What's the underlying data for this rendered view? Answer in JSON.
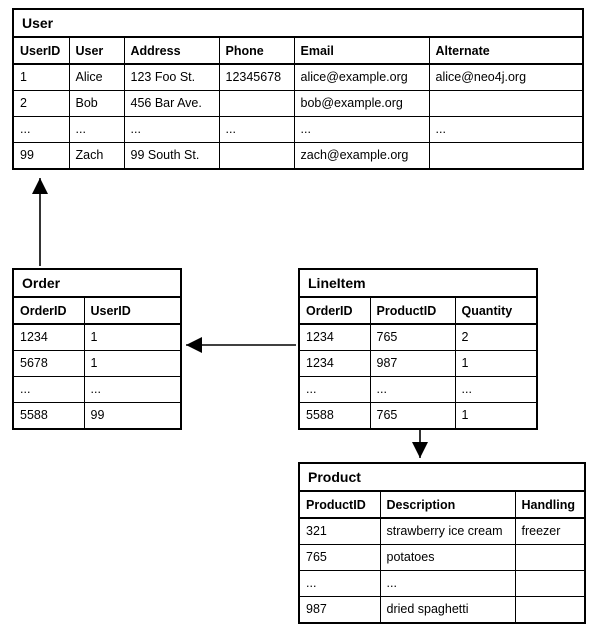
{
  "user": {
    "title": "User",
    "headers": [
      "UserID",
      "User",
      "Address",
      "Phone",
      "Email",
      "Alternate"
    ],
    "rows": [
      [
        "1",
        "Alice",
        "123 Foo St.",
        "12345678",
        "alice@example.org",
        "alice@neo4j.org"
      ],
      [
        "2",
        "Bob",
        "456 Bar Ave.",
        "",
        "bob@example.org",
        ""
      ],
      [
        "...",
        "...",
        "...",
        "...",
        "...",
        "..."
      ],
      [
        "99",
        "Zach",
        "99 South St.",
        "",
        "zach@example.org",
        ""
      ]
    ]
  },
  "order": {
    "title": "Order",
    "headers": [
      "OrderID",
      "UserID"
    ],
    "rows": [
      [
        "1234",
        "1"
      ],
      [
        "5678",
        "1"
      ],
      [
        "...",
        "..."
      ],
      [
        "5588",
        "99"
      ]
    ]
  },
  "lineitem": {
    "title": "LineItem",
    "headers": [
      "OrderID",
      "ProductID",
      "Quantity"
    ],
    "rows": [
      [
        "1234",
        "765",
        "2"
      ],
      [
        "1234",
        "987",
        "1"
      ],
      [
        "...",
        "...",
        "..."
      ],
      [
        "5588",
        "765",
        "1"
      ]
    ]
  },
  "product": {
    "title": "Product",
    "headers": [
      "ProductID",
      "Description",
      "Handling"
    ],
    "rows": [
      [
        "321",
        "strawberry ice cream",
        "freezer"
      ],
      [
        "765",
        "potatoes",
        ""
      ],
      [
        "...",
        "...",
        ""
      ],
      [
        "987",
        "dried spaghetti",
        ""
      ]
    ]
  },
  "relationships": [
    {
      "from": "Order.UserID",
      "to": "User.UserID"
    },
    {
      "from": "LineItem.OrderID",
      "to": "Order.OrderID"
    },
    {
      "from": "LineItem.ProductID",
      "to": "Product.ProductID"
    }
  ]
}
